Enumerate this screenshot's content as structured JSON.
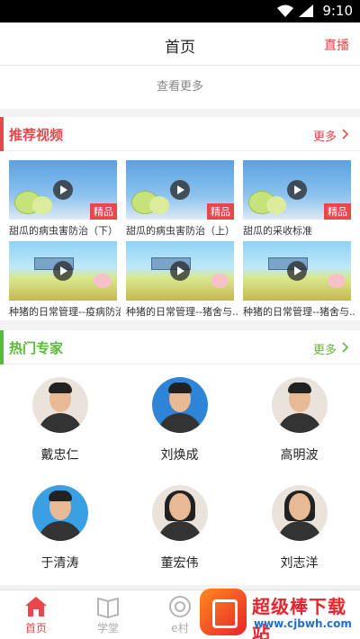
{
  "status_bar": {
    "time": "9:10"
  },
  "header": {
    "title": "首页",
    "live_label": "直播"
  },
  "see_more": "查看更多",
  "recommended": {
    "title": "推荐视频",
    "more_label": "更多",
    "accent": "#e8474c",
    "videos": [
      {
        "title": "甜瓜的病虫害防治（下）",
        "badge": "精品",
        "thumb": "melon"
      },
      {
        "title": "甜瓜的病虫害防治（上）",
        "badge": "精品",
        "thumb": "melon"
      },
      {
        "title": "甜瓜的采收标准",
        "badge": "精品",
        "thumb": "melon"
      },
      {
        "title": "种猪的日常管理--疫病防治",
        "badge": "",
        "thumb": "pig"
      },
      {
        "title": "种猪的日常管理--猪舍与...",
        "badge": "",
        "thumb": "pig"
      },
      {
        "title": "种猪的日常管理--猪舍与...",
        "badge": "",
        "thumb": "pig"
      }
    ]
  },
  "experts": {
    "title": "热门专家",
    "more_label": "更多",
    "accent": "#5ab937",
    "list": [
      {
        "name": "戴忠仁"
      },
      {
        "name": "刘焕成"
      },
      {
        "name": "高明波"
      },
      {
        "name": "于清涛"
      },
      {
        "name": "董宏伟"
      },
      {
        "name": "刘志洋"
      }
    ]
  },
  "tabbar": {
    "tabs": [
      {
        "label": "首页",
        "icon": "home-icon",
        "active": true
      },
      {
        "label": "学堂",
        "icon": "book-icon",
        "active": false
      },
      {
        "label": "e村",
        "icon": "circle-icon",
        "active": false
      }
    ]
  },
  "watermark": {
    "text": "超级棒下载站",
    "url": "www.cjbwh.com"
  }
}
